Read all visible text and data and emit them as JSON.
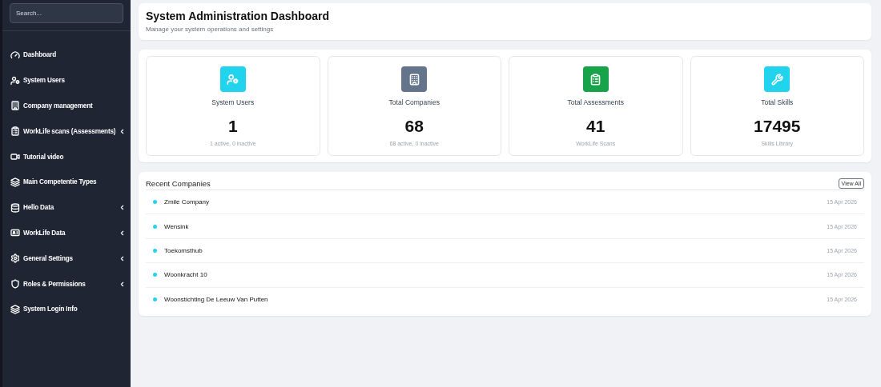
{
  "sidebar": {
    "search": {
      "placeholder": "Search..."
    },
    "items": [
      {
        "label": "Dashboard",
        "has_submenu": false
      },
      {
        "label": "System Users",
        "has_submenu": false
      },
      {
        "label": "Company management",
        "has_submenu": false
      },
      {
        "label": "WorkLife scans (Assessments)",
        "has_submenu": true
      },
      {
        "label": "Tutorial video",
        "has_submenu": false
      },
      {
        "label": "Main Competentie Types",
        "has_submenu": false
      },
      {
        "label": "Hello Data",
        "has_submenu": true
      },
      {
        "label": "WorkLife Data",
        "has_submenu": true
      },
      {
        "label": "General Settings",
        "has_submenu": true
      },
      {
        "label": "Roles & Permissions",
        "has_submenu": true
      },
      {
        "label": "System Login Info",
        "has_submenu": false
      }
    ]
  },
  "header": {
    "title": "System Administration Dashboard",
    "subtitle": "Manage your system operations and settings"
  },
  "stats": [
    {
      "label": "System Users",
      "value": "1",
      "note": "1 active, 0 inactive",
      "color": "#22d3ee"
    },
    {
      "label": "Total Companies",
      "value": "68",
      "note": "68 active, 0 inactive",
      "color": "#64748b"
    },
    {
      "label": "Total Assessments",
      "value": "41",
      "note": "WorkLife Scans",
      "color": "#16a34a"
    },
    {
      "label": "Total Skills",
      "value": "17495",
      "note": "Skills Library",
      "color": "#22d3ee"
    }
  ],
  "recent_companies": {
    "title": "Recent Companies",
    "view_all": "View All",
    "rows": [
      {
        "name": "Zmile Company",
        "date": "15 Apr 2026"
      },
      {
        "name": "Wensink",
        "date": "15 Apr 2026"
      },
      {
        "name": "Toekomsthub",
        "date": "15 Apr 2026"
      },
      {
        "name": "Woonkracht 10",
        "date": "15 Apr 2026"
      },
      {
        "name": "Woonstichting De Leeuw Van Putten",
        "date": "15 Apr 2026"
      }
    ]
  }
}
